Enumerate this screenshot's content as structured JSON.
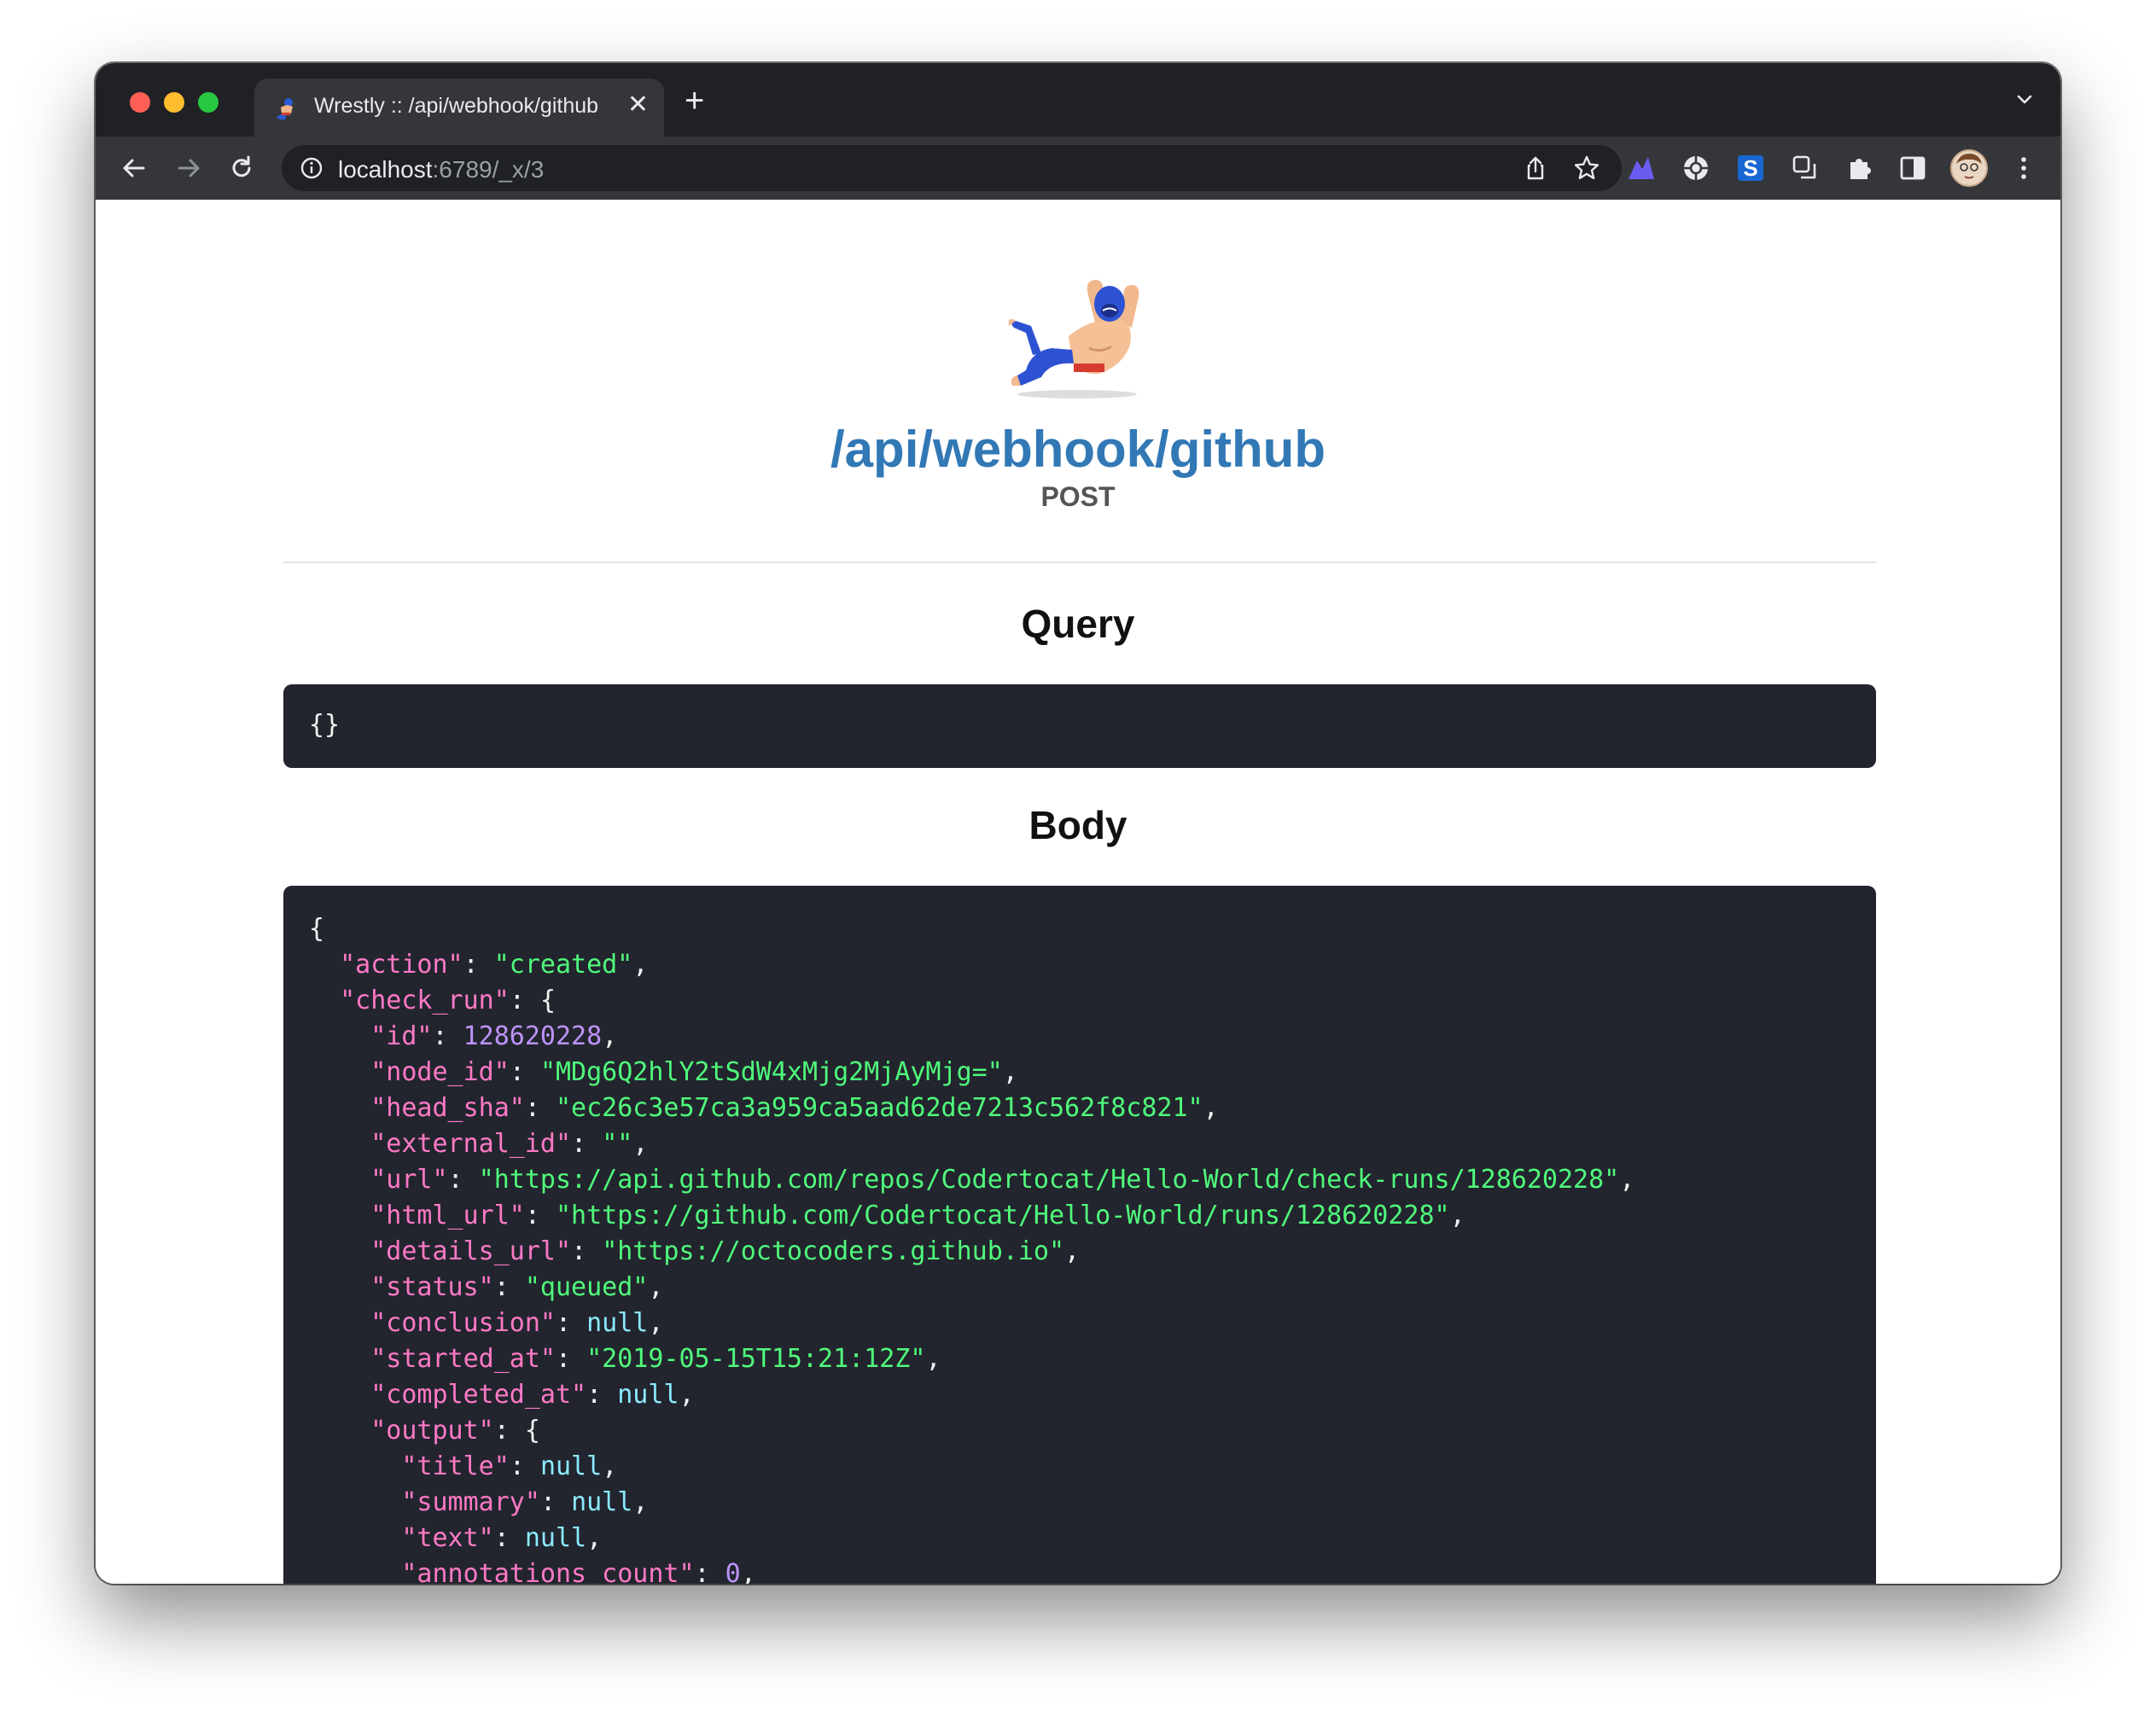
{
  "browser": {
    "tab_title": "Wrestly :: /api/webhook/github",
    "tab_close": "✕",
    "new_tab": "+",
    "url_host": "localhost",
    "url_rest": ":6789/_x/3"
  },
  "page": {
    "title": "/api/webhook/github",
    "method": "POST",
    "query_heading": "Query",
    "query_value": "{}",
    "body_heading": "Body"
  },
  "body_lines": [
    {
      "indent": 0,
      "open": "{"
    },
    {
      "indent": 1,
      "key": "action",
      "string": "created",
      "comma": true
    },
    {
      "indent": 1,
      "key": "check_run",
      "open": "{"
    },
    {
      "indent": 2,
      "key": "id",
      "number": "128620228",
      "comma": true
    },
    {
      "indent": 2,
      "key": "node_id",
      "string": "MDg6Q2hlY2tSdW4xMjg2MjAyMjg=",
      "comma": true
    },
    {
      "indent": 2,
      "key": "head_sha",
      "string": "ec26c3e57ca3a959ca5aad62de7213c562f8c821",
      "comma": true
    },
    {
      "indent": 2,
      "key": "external_id",
      "string": "",
      "comma": true
    },
    {
      "indent": 2,
      "key": "url",
      "string": "https://api.github.com/repos/Codertocat/Hello-World/check-runs/128620228",
      "comma": true
    },
    {
      "indent": 2,
      "key": "html_url",
      "string": "https://github.com/Codertocat/Hello-World/runs/128620228",
      "comma": true
    },
    {
      "indent": 2,
      "key": "details_url",
      "string": "https://octocoders.github.io",
      "comma": true
    },
    {
      "indent": 2,
      "key": "status",
      "string": "queued",
      "comma": true
    },
    {
      "indent": 2,
      "key": "conclusion",
      "literal": "null",
      "comma": true
    },
    {
      "indent": 2,
      "key": "started_at",
      "string": "2019-05-15T15:21:12Z",
      "comma": true
    },
    {
      "indent": 2,
      "key": "completed_at",
      "literal": "null",
      "comma": true
    },
    {
      "indent": 2,
      "key": "output",
      "open": "{"
    },
    {
      "indent": 3,
      "key": "title",
      "literal": "null",
      "comma": true
    },
    {
      "indent": 3,
      "key": "summary",
      "literal": "null",
      "comma": true
    },
    {
      "indent": 3,
      "key": "text",
      "literal": "null",
      "comma": true
    },
    {
      "indent": 3,
      "key": "annotations_count",
      "number": "0",
      "comma": true
    }
  ],
  "colors": {
    "title": "#3178b5",
    "code_background": "#22252e",
    "json_key": "#ff79c6",
    "json_string": "#50fa7b",
    "json_number": "#bd93f9",
    "json_null": "#8be9fd"
  },
  "icons": [
    "favicon-wrestler-icon",
    "close-icon",
    "new-tab-icon",
    "tab-search-icon",
    "back-arrow-icon",
    "forward-arrow-icon",
    "reload-icon",
    "site-info-icon",
    "share-icon",
    "bookmark-star-icon",
    "extension-mountain-icon",
    "extension-crosshair-icon",
    "extension-s-icon",
    "extension-copy-icon",
    "extensions-puzzle-icon",
    "side-panel-icon",
    "profile-avatar-icon",
    "menu-kebab-icon",
    "wrestler-logo"
  ]
}
